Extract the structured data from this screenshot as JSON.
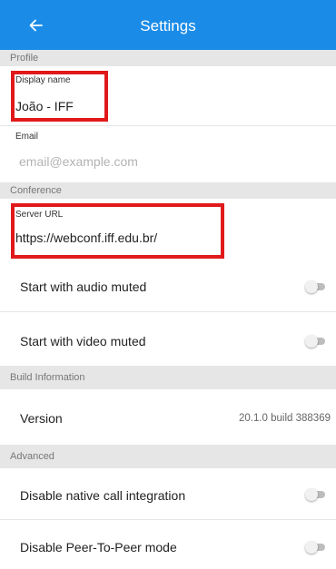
{
  "header": {
    "title": "Settings",
    "back_icon": "arrow-left-icon",
    "bg_color": "#1a8ce8"
  },
  "sections": {
    "profile": "Profile",
    "conference": "Conference",
    "build_information": "Build Information",
    "advanced": "Advanced"
  },
  "profile": {
    "display_name_label": "Display name",
    "display_name_value": "João - IFF",
    "email_label": "Email",
    "email_placeholder": "email@example.com"
  },
  "conference": {
    "server_url_label": "Server URL",
    "server_url_value": "https://webconf.iff.edu.br/",
    "start_audio_muted_label": "Start with audio muted",
    "start_audio_muted": false,
    "start_video_muted_label": "Start with video muted",
    "start_video_muted": false
  },
  "build": {
    "version_label": "Version",
    "version_value": "20.1.0 build 388369"
  },
  "advanced": {
    "disable_native_call_label": "Disable native call integration",
    "disable_native_call": false,
    "disable_p2p_label": "Disable Peer-To-Peer mode",
    "disable_p2p": false
  },
  "highlight_color": "#e0191b"
}
